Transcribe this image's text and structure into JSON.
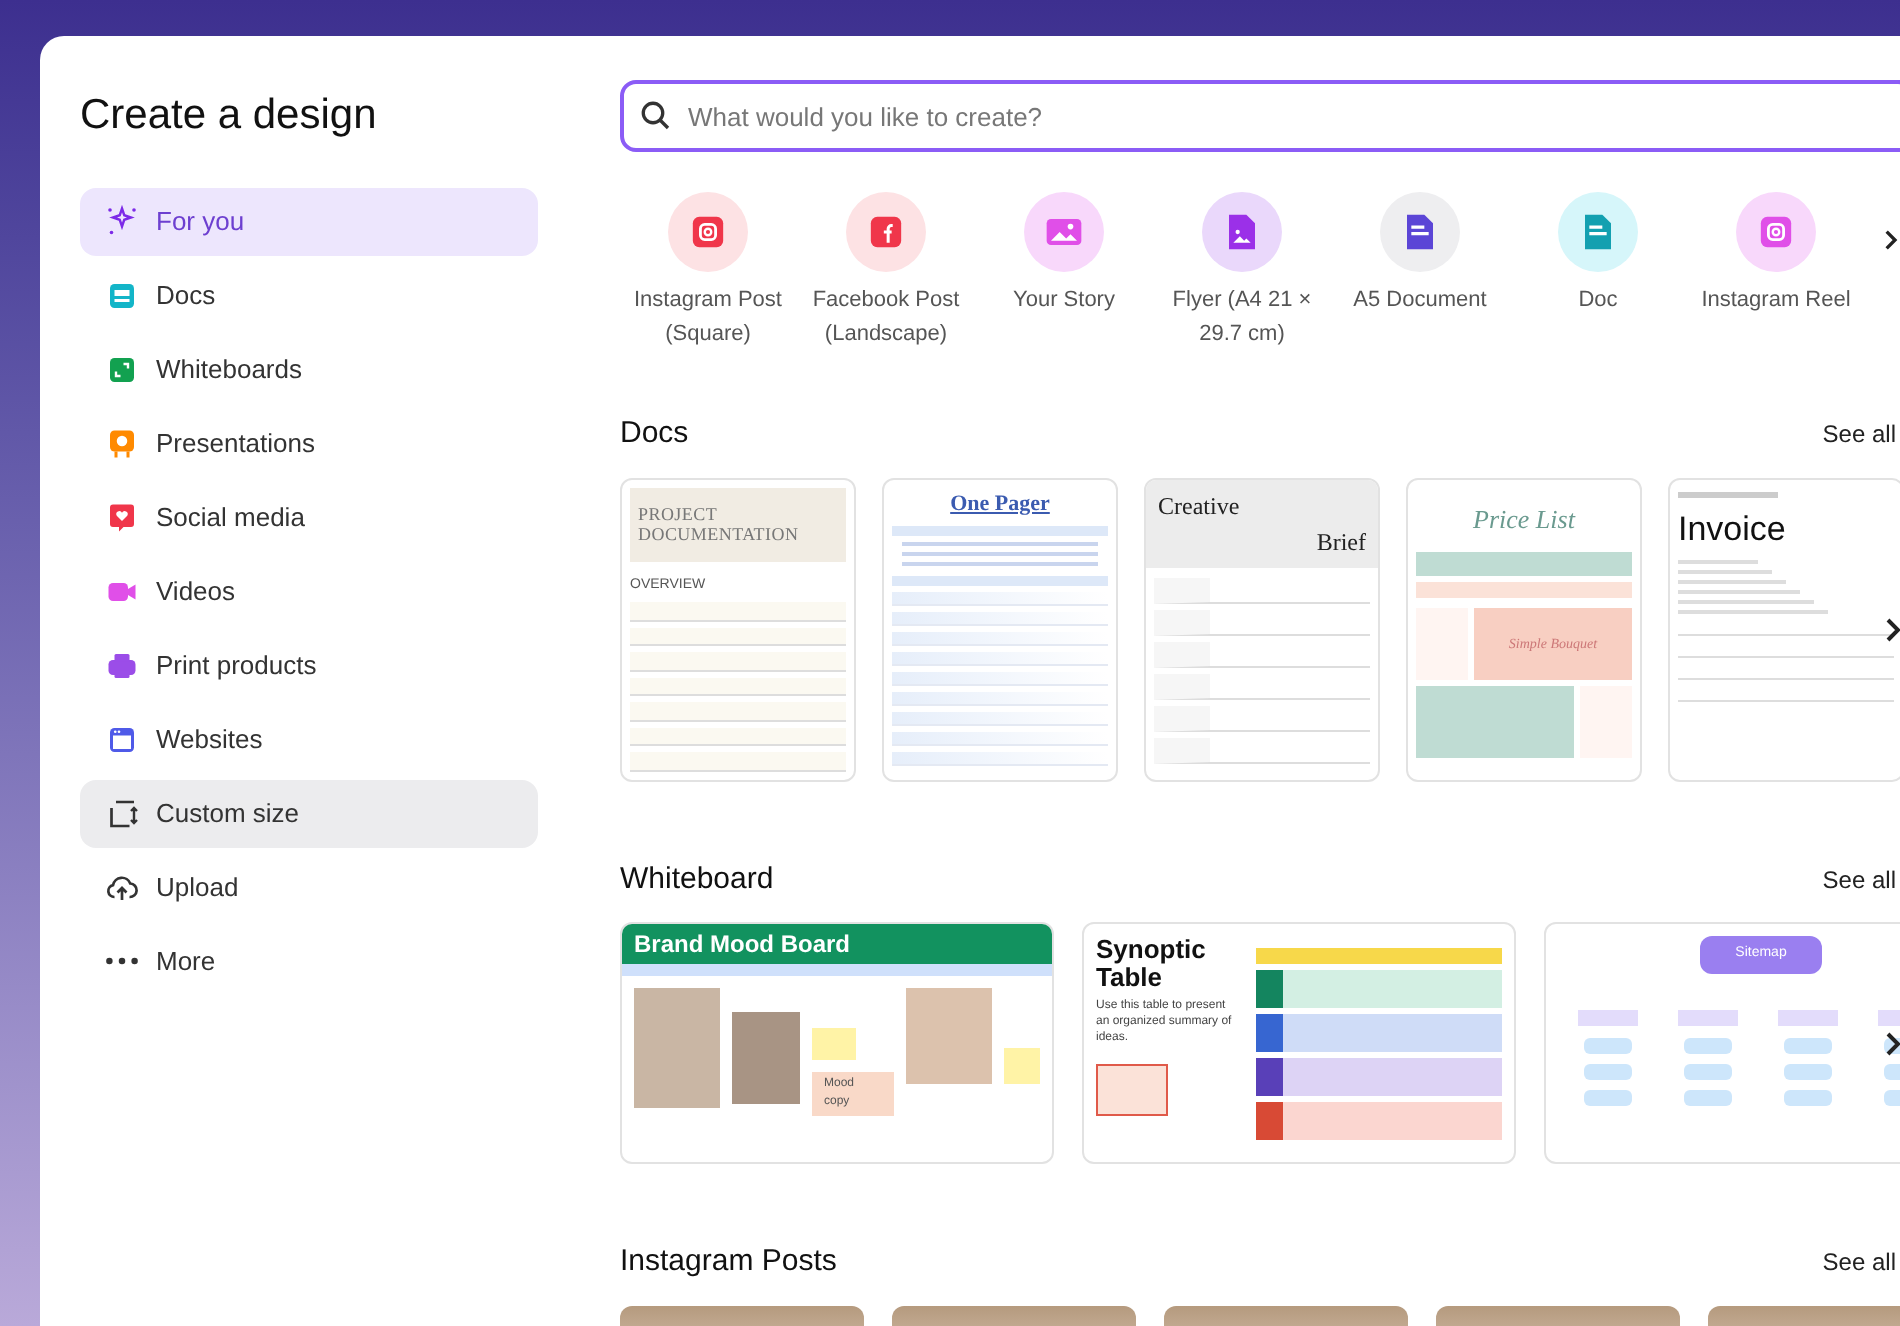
{
  "dialog": {
    "title": "Create a design"
  },
  "sidebar": {
    "items": [
      {
        "label": "For you",
        "selected": true,
        "hovered": false,
        "color": "#7d2ae8"
      },
      {
        "label": "Docs",
        "selected": false,
        "hovered": false,
        "color": "#13b5c8"
      },
      {
        "label": "Whiteboards",
        "selected": false,
        "hovered": false,
        "color": "#12a150"
      },
      {
        "label": "Presentations",
        "selected": false,
        "hovered": false,
        "color": "#ff8a00"
      },
      {
        "label": "Social media",
        "selected": false,
        "hovered": false,
        "color": "#f0364a"
      },
      {
        "label": "Videos",
        "selected": false,
        "hovered": false,
        "color": "#e04fe8"
      },
      {
        "label": "Print products",
        "selected": false,
        "hovered": false,
        "color": "#9b4de8"
      },
      {
        "label": "Websites",
        "selected": false,
        "hovered": false,
        "color": "#4f5ae8"
      },
      {
        "label": "Custom size",
        "selected": false,
        "hovered": true,
        "color": "#333333"
      },
      {
        "label": "Upload",
        "selected": false,
        "hovered": false,
        "color": "#333333"
      },
      {
        "label": "More",
        "selected": false,
        "hovered": false,
        "color": "#333333"
      }
    ]
  },
  "search": {
    "placeholder": "What would you like to create?"
  },
  "quick_create": [
    {
      "label": "Instagram Post (Square)",
      "color": "#f0364a",
      "kind": "instagram"
    },
    {
      "label": "Facebook Post (Landscape)",
      "color": "#f0364a",
      "kind": "facebook"
    },
    {
      "label": "Your Story",
      "color": "#e04fe8",
      "kind": "image"
    },
    {
      "label": "Flyer (A4 21 × 29.7 cm)",
      "color": "#9b30e8",
      "kind": "file-image"
    },
    {
      "label": "A5 Document",
      "color": "#5b45d6",
      "kind": "doc"
    },
    {
      "label": "Doc",
      "color": "#13a0b0",
      "kind": "doc"
    },
    {
      "label": "Instagram Reel",
      "color": "#e04fe8",
      "kind": "instagram"
    }
  ],
  "sections": [
    {
      "title": "Docs",
      "link": "See all",
      "kind": "docs",
      "cards": [
        {
          "kind": "project",
          "title": "PROJECT DOCUMENTATION",
          "subtitle": "OVERVIEW"
        },
        {
          "kind": "one-pager",
          "title": "One Pager"
        },
        {
          "kind": "brief",
          "title": "Creative",
          "subtitle": "Brief"
        },
        {
          "kind": "price-list",
          "title": "Price List",
          "subtitle": "Simple Bouquet"
        },
        {
          "kind": "invoice",
          "title": "Invoice"
        }
      ]
    },
    {
      "title": "Whiteboard",
      "link": "See all",
      "kind": "whiteboards",
      "cards": [
        {
          "kind": "mood-board",
          "title": "Brand Mood Board",
          "subtitle": "Mood copy"
        },
        {
          "kind": "synoptic",
          "title": "Synoptic Table",
          "subtitle": "Use this table to present an organized summary of ideas."
        },
        {
          "kind": "sitemap",
          "title": "Sitemap"
        }
      ]
    },
    {
      "title": "Instagram Posts",
      "link": "See all",
      "kind": "photos",
      "cards": [
        {
          "kind": "photo"
        },
        {
          "kind": "photo"
        },
        {
          "kind": "photo"
        },
        {
          "kind": "photo"
        },
        {
          "kind": "photo"
        }
      ]
    }
  ]
}
